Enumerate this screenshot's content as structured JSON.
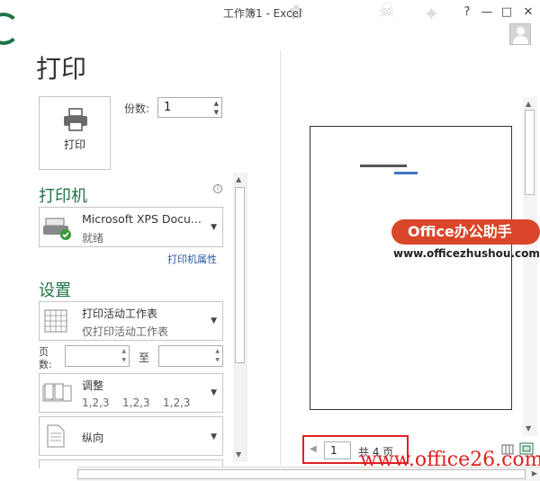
{
  "window": {
    "title": "工作簿1 - Excel",
    "help": "?",
    "minimize": "—",
    "restore": "□",
    "close": "✕"
  },
  "page_title": "打印",
  "print_button": {
    "label": "打印",
    "icon": "printer-icon"
  },
  "copies": {
    "label": "份数:",
    "value": "1"
  },
  "printer": {
    "heading": "打印机",
    "name": "Microsoft XPS Docu...",
    "status": "就绪",
    "properties_link": "打印机属性"
  },
  "settings": {
    "heading": "设置",
    "scope": {
      "main": "打印活动工作表",
      "sub": "仅打印活动工作表"
    },
    "pages_label_1": "页",
    "pages_label_2": "数:",
    "pages_to": "至",
    "collate": {
      "main": "调整",
      "sub": [
        "1,2,3",
        "1,2,3",
        "1,2,3"
      ]
    },
    "orientation": {
      "main": "纵向"
    }
  },
  "preview": {
    "current_page": "1",
    "total_pages": "共 4 页"
  },
  "watermark": {
    "badge": "Office办公助手",
    "url": "www.officezhushou.com",
    "bottom": "www.office26.com"
  },
  "colors": {
    "accent": "#217346",
    "link": "#2b579a",
    "highlight": "#dd2222"
  }
}
